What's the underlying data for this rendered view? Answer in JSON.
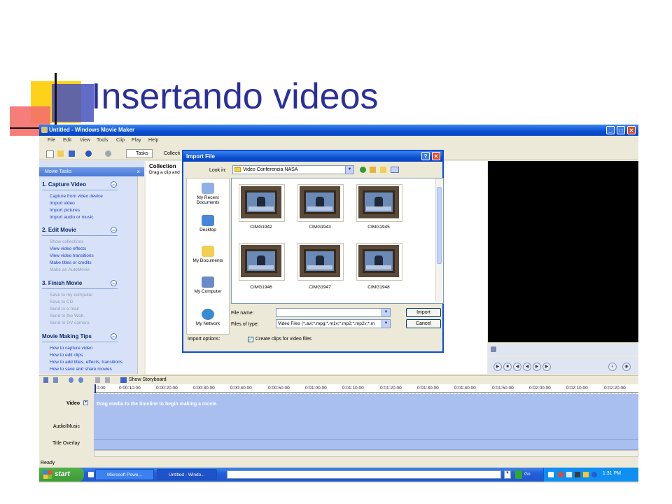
{
  "slide": {
    "title": "Insertando videos"
  },
  "window": {
    "title": "Untitled - Windows Movie Maker",
    "controls": [
      "_",
      "□",
      "✕"
    ]
  },
  "menu": [
    "File",
    "Edit",
    "View",
    "Tools",
    "Clip",
    "Play",
    "Help"
  ],
  "toolbar": {
    "tasks_label": "Tasks",
    "collections_label": "Collecti"
  },
  "tasks_pane": {
    "header": "Movie Tasks",
    "close": "×",
    "sections": [
      {
        "title": "1. Capture Video",
        "items": [
          {
            "label": "Capture from video device",
            "enabled": true
          },
          {
            "label": "Import video",
            "enabled": true
          },
          {
            "label": "Import pictures",
            "enabled": true
          },
          {
            "label": "Import audio or music",
            "enabled": true
          }
        ]
      },
      {
        "title": "2. Edit Movie",
        "items": [
          {
            "label": "Show collections",
            "enabled": false
          },
          {
            "label": "View video effects",
            "enabled": true
          },
          {
            "label": "View video transitions",
            "enabled": true
          },
          {
            "label": "Make titles or credits",
            "enabled": true
          },
          {
            "label": "Make an AutoMovie",
            "enabled": false
          }
        ]
      },
      {
        "title": "3. Finish Movie",
        "items": [
          {
            "label": "Save to my computer",
            "enabled": false
          },
          {
            "label": "Save to CD",
            "enabled": false
          },
          {
            "label": "Send in e-mail",
            "enabled": false
          },
          {
            "label": "Send to the Web",
            "enabled": false
          },
          {
            "label": "Send to DV camera",
            "enabled": false
          }
        ]
      },
      {
        "title": "Movie Making Tips",
        "items": [
          {
            "label": "How to capture video",
            "enabled": true
          },
          {
            "label": "How to edit clips",
            "enabled": true
          },
          {
            "label": "How to add titles, effects, transitions",
            "enabled": true
          },
          {
            "label": "How to save and share movies",
            "enabled": true
          }
        ]
      }
    ]
  },
  "collection": {
    "title": "Collection",
    "hint": "Drag a clip and"
  },
  "dialog": {
    "title": "Import File",
    "help": "?",
    "close": "✕",
    "look_in_label": "Look in:",
    "look_in_value": "Video Conferencia NASA",
    "places": [
      "My Recent Documents",
      "Desktop",
      "My Documents",
      "My Computer",
      "My Network"
    ],
    "files": [
      "CIMG1942",
      "CIMG1943",
      "CIMG1945",
      "CIMG1946",
      "CIMG1947",
      "CIMG1948"
    ],
    "file_name_label": "File name:",
    "file_name_value": "",
    "file_type_label": "Files of type:",
    "file_type_value": "Video Files (*.avi;*.mpg;*.m1v;*.mp2;*.mp2v;*.m",
    "import_button": "Import",
    "cancel_button": "Cancel",
    "options_label": "Import options:",
    "option_checkbox": "Create clips for video files",
    "option_checked": true
  },
  "timeline": {
    "storyboard_label": "Show Storyboard",
    "ticks": [
      "0:00",
      "0:00:10.00",
      "0:00:20.00",
      "0:00:30.00",
      "0:00:40.00",
      "0:00:50.00",
      "0:01:00.00",
      "0:01:10.00",
      "0:01:20.00",
      "0:01:30.00",
      "0:01:40.00",
      "0:01:50.00",
      "0:02:00.00",
      "0:02:10.00",
      "0:02:20.00"
    ],
    "video_label": "Video",
    "video_hint": "Drag media to the timeline to begin making a movie.",
    "audio_label": "Audio/Music",
    "title_label": "Title Overlay"
  },
  "status": {
    "text": "Ready"
  },
  "taskbar": {
    "start": "start",
    "buttons": [
      "Microsoft Powe...",
      "Untitled - Windo..."
    ],
    "go": "Go",
    "clock": "1:31 PM"
  }
}
